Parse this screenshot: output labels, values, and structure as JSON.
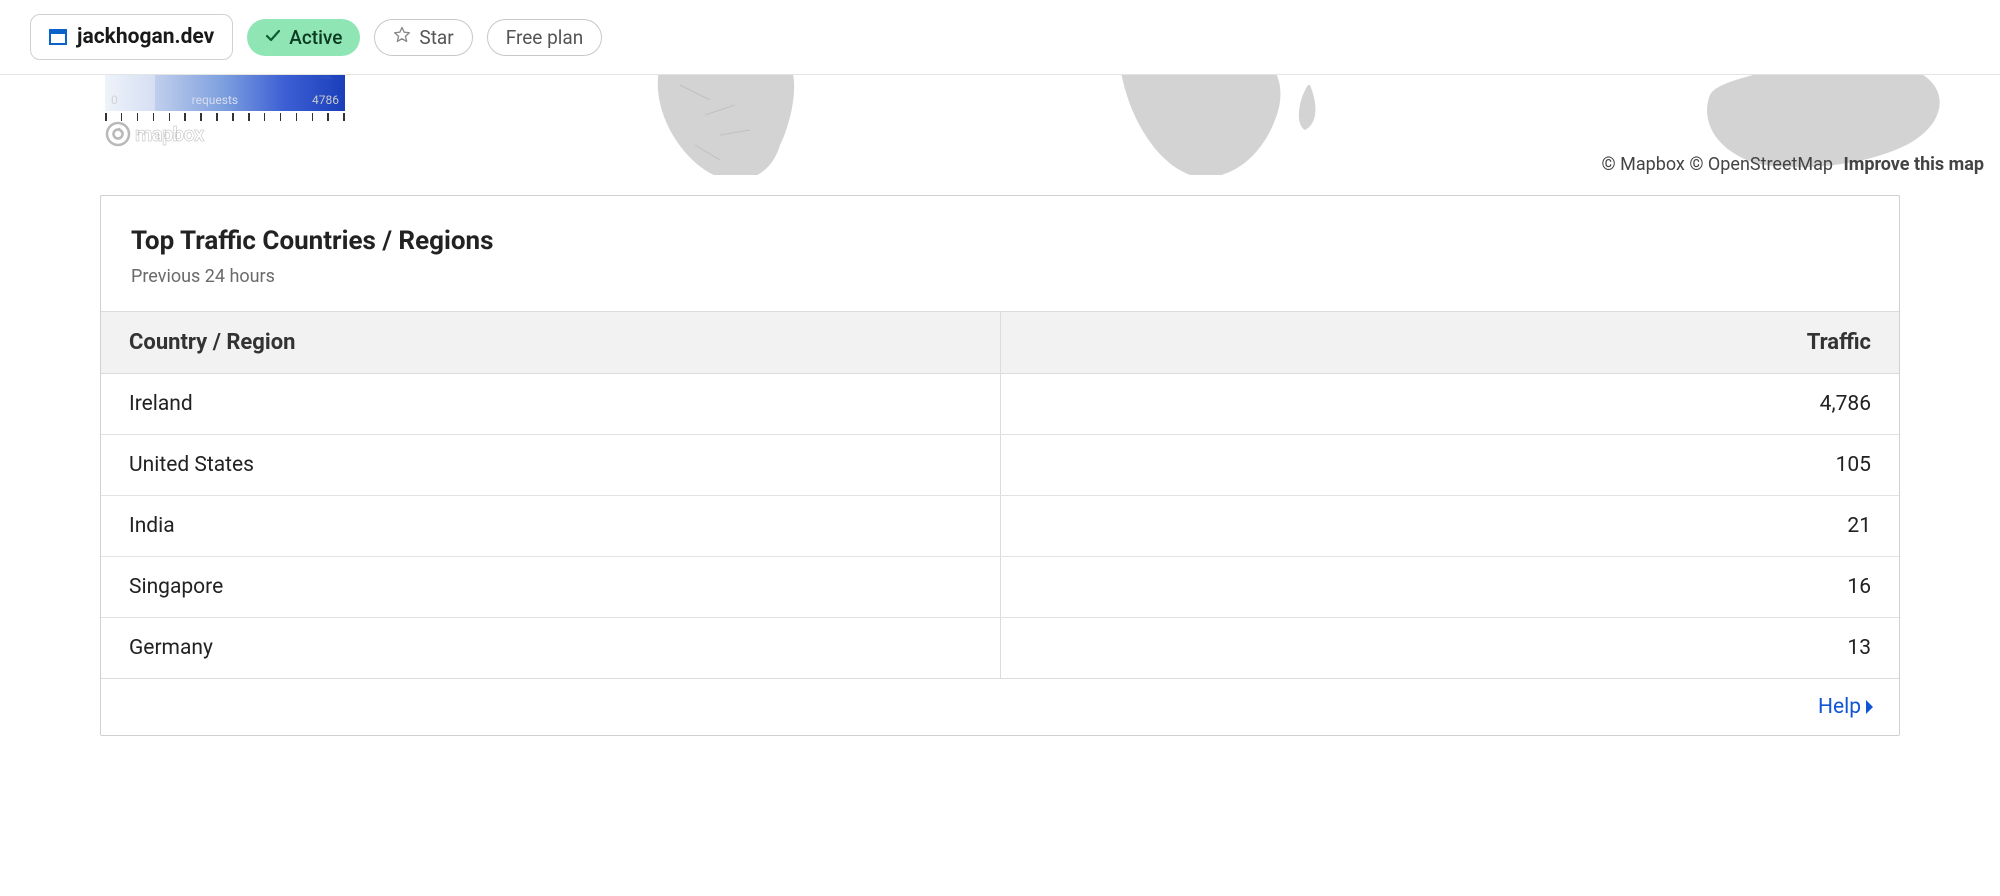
{
  "header": {
    "site_name": "jackhogan.dev",
    "status_label": "Active",
    "star_label": "Star",
    "plan_label": "Free plan"
  },
  "map": {
    "legend_min": "0",
    "legend_mid": "requests",
    "legend_max": "4786",
    "attribution_mapbox": "© Mapbox",
    "attribution_osm": "© OpenStreetMap",
    "improve_label": "Improve this map",
    "logo_text": "mapbox"
  },
  "card": {
    "title": "Top Traffic Countries / Regions",
    "subtitle": "Previous 24 hours",
    "col_country": "Country / Region",
    "col_traffic": "Traffic",
    "rows": [
      {
        "name": "Ireland",
        "traffic": "4,786"
      },
      {
        "name": "United States",
        "traffic": "105"
      },
      {
        "name": "India",
        "traffic": "21"
      },
      {
        "name": "Singapore",
        "traffic": "16"
      },
      {
        "name": "Germany",
        "traffic": "13"
      }
    ],
    "help_label": "Help"
  }
}
